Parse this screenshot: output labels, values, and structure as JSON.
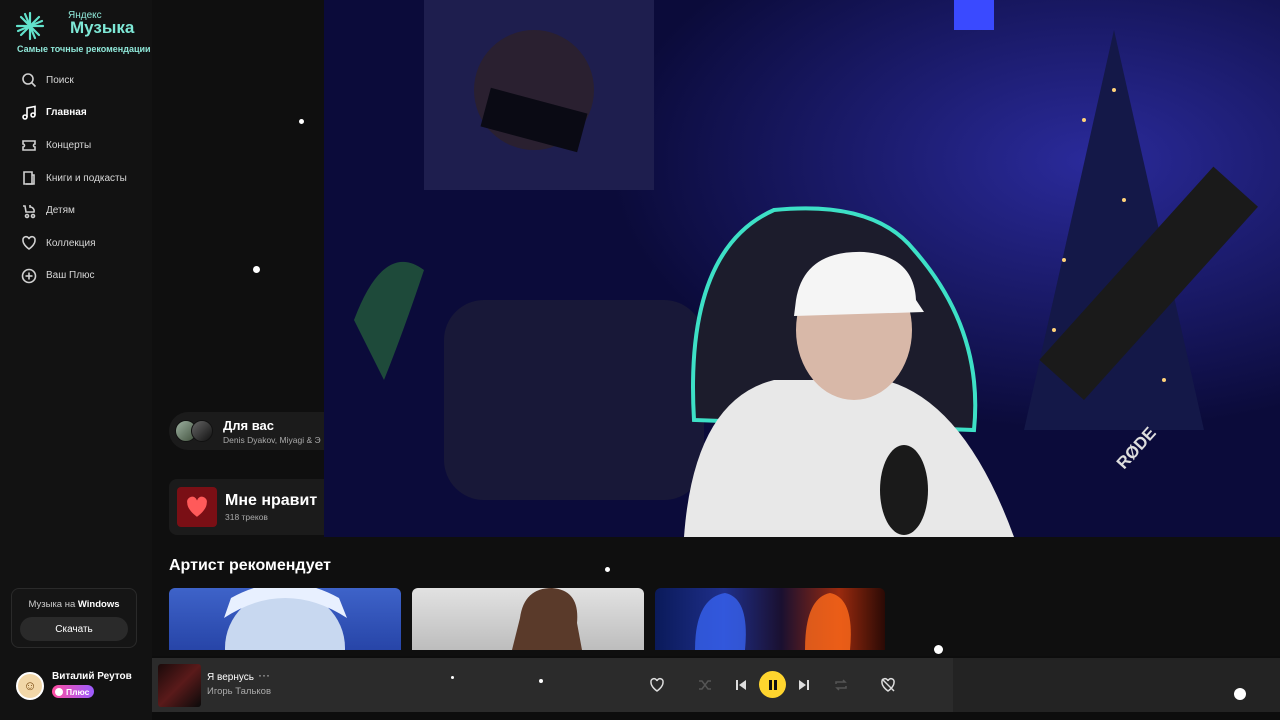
{
  "logo": {
    "small": "Яндекс",
    "big": "Музыка",
    "tagline": "Самые точные рекомендации"
  },
  "nav": [
    {
      "label": "Поиск",
      "icon": "search-icon"
    },
    {
      "label": "Главная",
      "icon": "music-note-icon",
      "active": true
    },
    {
      "label": "Концерты",
      "icon": "ticket-icon"
    },
    {
      "label": "Книги и подкасты",
      "icon": "book-icon"
    },
    {
      "label": "Детям",
      "icon": "stroller-icon"
    },
    {
      "label": "Коллекция",
      "icon": "heart-icon"
    },
    {
      "label": "Ваш Плюс",
      "icon": "plus-icon"
    }
  ],
  "windows_promo": {
    "prefix": "Музыка на ",
    "app": "Windows",
    "button": "Скачать"
  },
  "user": {
    "name": "Виталий Реутов",
    "badge": "Плюс"
  },
  "cards": {
    "for_you": {
      "title": "Для вас",
      "subtitle": "Denis Dyakov, Miyagi & Э"
    },
    "liked": {
      "title": "Мне нравит",
      "subtitle": "318 треков"
    }
  },
  "section": {
    "title": "Артист рекомендует"
  },
  "player": {
    "track": "Я вернусь",
    "more": "···",
    "artist": "Игорь Тальков"
  },
  "video": {
    "mic_brand": "RØDE"
  },
  "colors": {
    "accent": "#ffd52e",
    "brand": "#7ee8d6"
  }
}
